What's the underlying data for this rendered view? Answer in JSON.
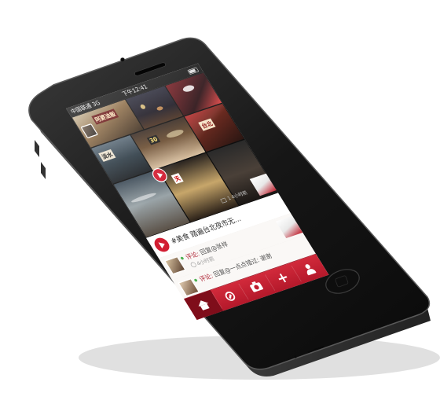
{
  "status_bar": {
    "carrier": "中国联通 3G",
    "time": "下午12:41"
  },
  "photo_signs": {
    "sign_1": "阿婆油飯",
    "sign_2": "淡水",
    "sign_3": "30",
    "sign_4": "台北",
    "sign_5": "天"
  },
  "post": {
    "stats": "1  4小时前",
    "caption": "#美食 踏遍台北夜市无..."
  },
  "comments": [
    {
      "label": "评论:",
      "text": "回复@张祥",
      "time": "4小时前"
    },
    {
      "label": "评论:",
      "text": "回复@一点点错过: 谢谢",
      "time": ""
    }
  ],
  "tab_bar": {
    "tabs": [
      {
        "name": "home",
        "icon": "home-icon"
      },
      {
        "name": "explore",
        "icon": "compass-icon"
      },
      {
        "name": "camera",
        "icon": "camera-icon"
      },
      {
        "name": "add",
        "icon": "plus-icon",
        "glyph": "+"
      },
      {
        "name": "profile",
        "icon": "user-icon"
      }
    ]
  },
  "colors": {
    "accent_red": "#d21e32",
    "phone_body": "#1a1a1a"
  }
}
